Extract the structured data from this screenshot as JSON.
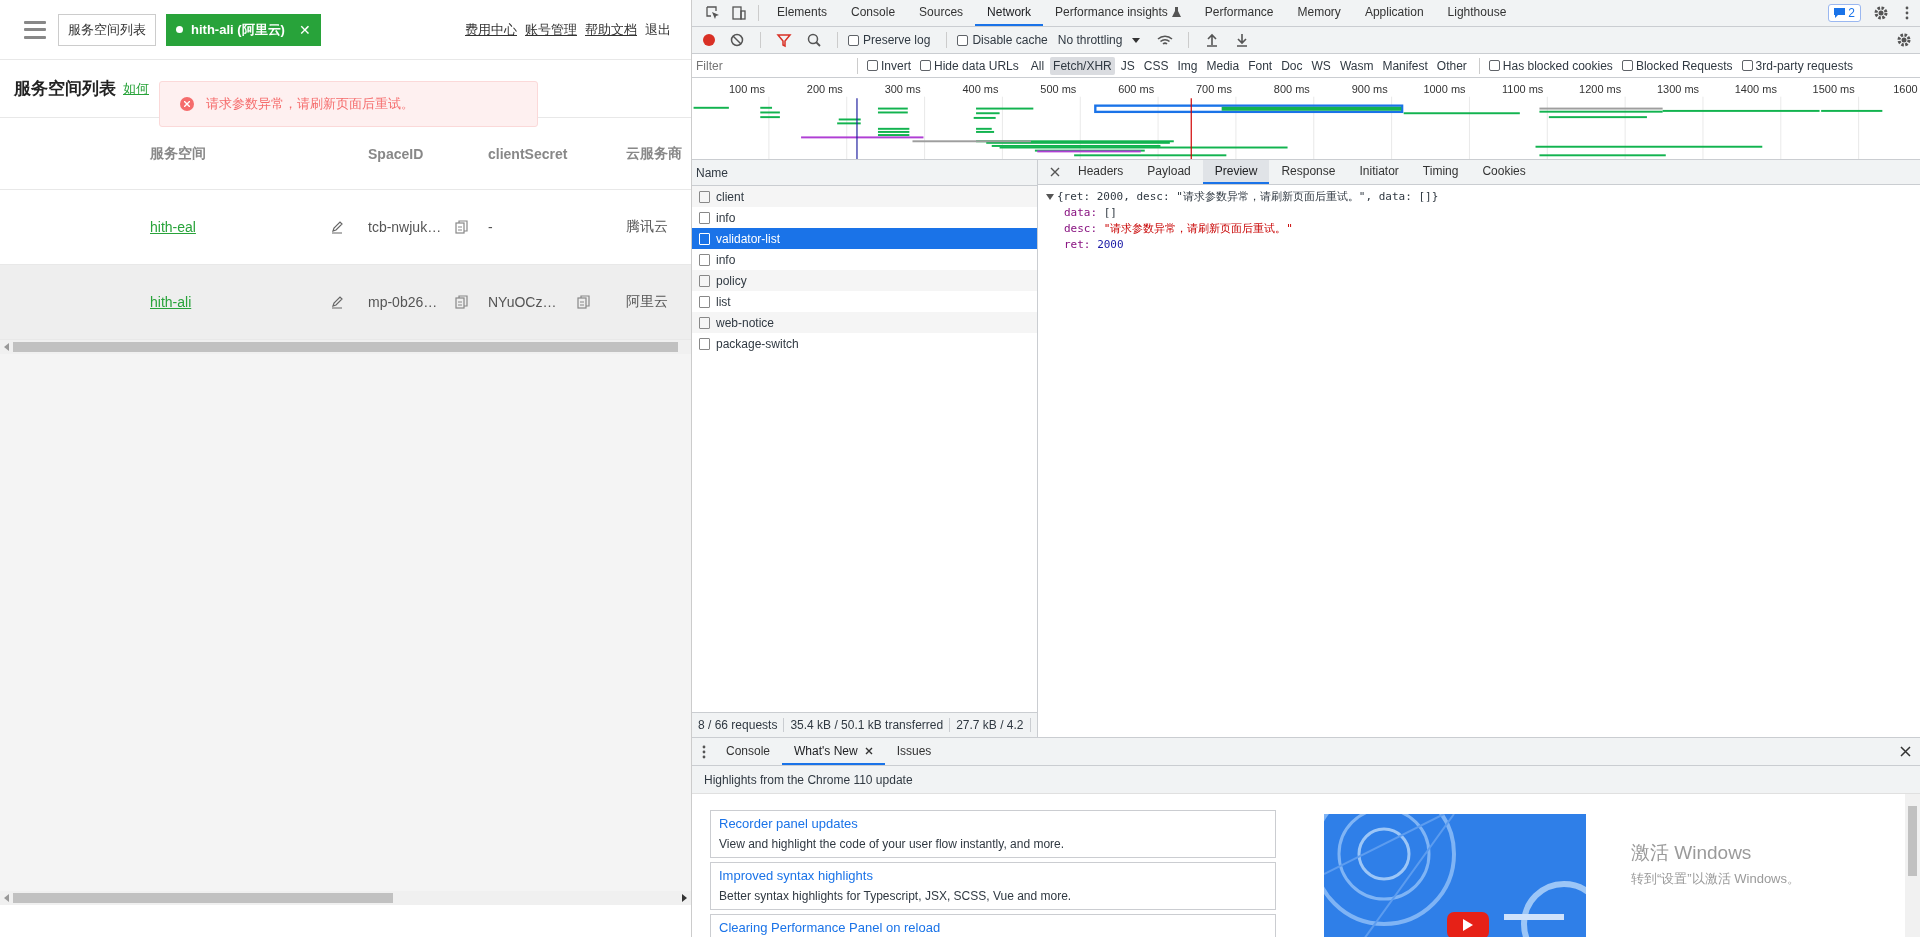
{
  "app": {
    "breadcrumb": "服务空间列表",
    "space_tag": {
      "label": "hith-ali (阿里云)",
      "close": "✕"
    },
    "top_links": [
      "费用中心",
      "账号管理",
      "帮助文档",
      "退出"
    ],
    "page_title": "服务空间列表",
    "help_link": "如何",
    "toast": {
      "message": "请求参数异常，请刷新页面后重试。"
    },
    "table": {
      "columns": [
        "服务空间",
        "SpaceID",
        "clientSecret",
        "云服务商"
      ],
      "rows": [
        {
          "name": "hith-eal",
          "space_id": "tcb-nwjuk…",
          "client_secret": "-",
          "provider": "腾讯云",
          "secret_copy": false,
          "hovered": false
        },
        {
          "name": "hith-ali",
          "space_id": "mp-0b26…",
          "client_secret": "NYuOCz…",
          "provider": "阿里云",
          "secret_copy": true,
          "hovered": true
        }
      ]
    }
  },
  "devtools": {
    "main_tabs": [
      {
        "label": "Elements",
        "selected": false
      },
      {
        "label": "Console",
        "selected": false
      },
      {
        "label": "Sources",
        "selected": false
      },
      {
        "label": "Network",
        "selected": true
      },
      {
        "label": "Performance insights",
        "selected": false,
        "experimental": true
      },
      {
        "label": "Performance",
        "selected": false
      },
      {
        "label": "Memory",
        "selected": false
      },
      {
        "label": "Application",
        "selected": false
      },
      {
        "label": "Lighthouse",
        "selected": false
      }
    ],
    "issues_badge": "2",
    "toolbar": {
      "recording": true,
      "preserve_log": {
        "label": "Preserve log",
        "checked": false
      },
      "disable_cache": {
        "label": "Disable cache",
        "checked": false
      },
      "throttling": "No throttling"
    },
    "filter": {
      "placeholder": "Filter",
      "options_before": [
        {
          "label": "Invert",
          "checked": false
        },
        {
          "label": "Hide data URLs",
          "checked": false
        }
      ],
      "types": [
        {
          "label": "All",
          "selected": false
        },
        {
          "label": "Fetch/XHR",
          "selected": true
        },
        {
          "label": "JS",
          "selected": false
        },
        {
          "label": "CSS",
          "selected": false
        },
        {
          "label": "Img",
          "selected": false
        },
        {
          "label": "Media",
          "selected": false
        },
        {
          "label": "Font",
          "selected": false
        },
        {
          "label": "Doc",
          "selected": false
        },
        {
          "label": "WS",
          "selected": false
        },
        {
          "label": "Wasm",
          "selected": false
        },
        {
          "label": "Manifest",
          "selected": false
        },
        {
          "label": "Other",
          "selected": false
        }
      ],
      "options_after": [
        {
          "label": "Has blocked cookies",
          "checked": false
        },
        {
          "label": "Blocked Requests",
          "checked": false
        },
        {
          "label": "3rd-party requests",
          "checked": false
        }
      ]
    },
    "overview_ticks": [
      "100 ms",
      "200 ms",
      "300 ms",
      "400 ms",
      "500 ms",
      "600 ms",
      "700 ms",
      "800 ms",
      "900 ms",
      "1000 ms",
      "1100 ms",
      "1200 ms",
      "1300 ms",
      "1400 ms",
      "1500 ms",
      "1600"
    ],
    "requests": {
      "header": "Name",
      "items": [
        {
          "name": "client",
          "selected": false
        },
        {
          "name": "info",
          "selected": false
        },
        {
          "name": "validator-list",
          "selected": true
        },
        {
          "name": "info",
          "selected": false
        },
        {
          "name": "policy",
          "selected": false
        },
        {
          "name": "list",
          "selected": false
        },
        {
          "name": "web-notice",
          "selected": false
        },
        {
          "name": "package-switch",
          "selected": false
        }
      ]
    },
    "status_bar": [
      "8 / 66 requests",
      "35.4 kB / 50.1 kB transferred",
      "27.7 kB / 4.2"
    ],
    "detail_tabs": [
      {
        "label": "Headers",
        "selected": false
      },
      {
        "label": "Payload",
        "selected": false
      },
      {
        "label": "Preview",
        "selected": true
      },
      {
        "label": "Response",
        "selected": false
      },
      {
        "label": "Initiator",
        "selected": false
      },
      {
        "label": "Timing",
        "selected": false
      },
      {
        "label": "Cookies",
        "selected": false
      }
    ],
    "preview": {
      "expanded": true,
      "summary": "{ret: 2000, desc: \"请求参数异常，请刷新页面后重试。\", data: []}",
      "props": [
        {
          "key": "data:",
          "value": "[]",
          "kind": "array"
        },
        {
          "key": "desc:",
          "value": "\"请求参数异常，请刷新页面后重试。\"",
          "kind": "string"
        },
        {
          "key": "ret:",
          "value": "2000",
          "kind": "number"
        }
      ]
    },
    "drawer": {
      "tabs": [
        {
          "label": "Console",
          "selected": false,
          "closable": false
        },
        {
          "label": "What's New",
          "selected": true,
          "closable": true
        },
        {
          "label": "Issues",
          "selected": false,
          "closable": false
        }
      ],
      "header": "Highlights from the Chrome 110 update",
      "cards": [
        {
          "title": "Recorder panel updates",
          "text": "View and highlight the code of your user flow instantly, and more."
        },
        {
          "title": "Improved syntax highlights",
          "text": "Better syntax highlights for Typescript, JSX, SCSS, Vue and more."
        },
        {
          "title": "Clearing Performance Panel on reload"
        }
      ]
    }
  },
  "windows_activation": {
    "title": "激活 Windows",
    "hint": "转到“设置”以激活 Windows。"
  }
}
